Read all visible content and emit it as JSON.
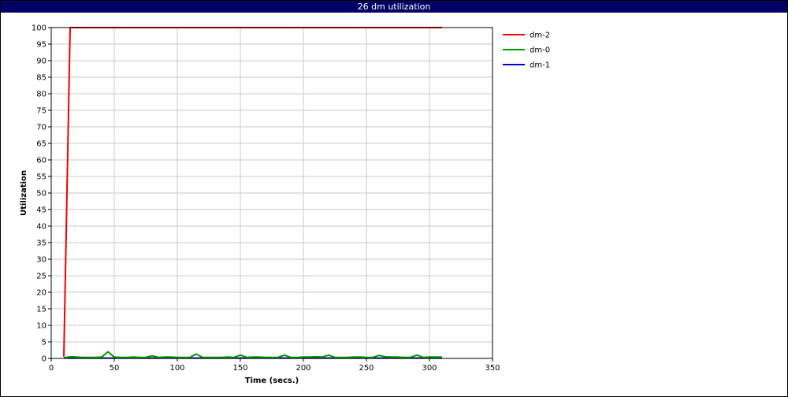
{
  "window": {
    "title": "26 dm utilization"
  },
  "chart_data": {
    "type": "line",
    "title": "26 dm utilization",
    "xlabel": "Time (secs.)",
    "ylabel": "Utilization",
    "xlim": [
      0,
      350
    ],
    "ylim": [
      0,
      100
    ],
    "xticks": [
      0,
      50,
      100,
      150,
      200,
      250,
      300,
      350
    ],
    "yticks": [
      0,
      5,
      10,
      15,
      20,
      25,
      30,
      35,
      40,
      45,
      50,
      55,
      60,
      65,
      70,
      75,
      80,
      85,
      90,
      95,
      100
    ],
    "grid": true,
    "legend_position": "right",
    "series": [
      {
        "name": "dm-2",
        "color": "#ee0000",
        "x": [
          10,
          15,
          20,
          25,
          30,
          35,
          40,
          45,
          50,
          55,
          60,
          65,
          70,
          75,
          80,
          85,
          90,
          95,
          100,
          105,
          110,
          115,
          120,
          125,
          130,
          135,
          140,
          145,
          150,
          155,
          160,
          165,
          170,
          175,
          180,
          185,
          190,
          195,
          200,
          205,
          210,
          215,
          220,
          225,
          230,
          235,
          240,
          245,
          250,
          255,
          260,
          265,
          270,
          275,
          280,
          285,
          290,
          295,
          300,
          305,
          310
        ],
        "y": [
          0.5,
          100,
          100,
          100,
          100,
          100,
          100,
          100,
          100,
          100,
          100,
          100,
          100,
          100,
          100,
          100,
          100,
          100,
          100,
          100,
          100,
          100,
          100,
          100,
          100,
          100,
          100,
          100,
          100,
          100,
          100,
          100,
          100,
          100,
          100,
          100,
          100,
          100,
          100,
          100,
          100,
          100,
          100,
          100,
          100,
          100,
          100,
          100,
          100,
          100,
          100,
          100,
          100,
          100,
          100,
          100,
          100,
          100,
          100,
          100,
          100
        ]
      },
      {
        "name": "dm-0",
        "color": "#009900",
        "x": [
          10,
          15,
          20,
          25,
          30,
          35,
          40,
          45,
          50,
          55,
          60,
          65,
          70,
          75,
          80,
          85,
          90,
          95,
          100,
          105,
          110,
          115,
          120,
          125,
          130,
          135,
          140,
          145,
          150,
          155,
          160,
          165,
          170,
          175,
          180,
          185,
          190,
          195,
          200,
          205,
          210,
          215,
          220,
          225,
          230,
          235,
          240,
          245,
          250,
          255,
          260,
          265,
          270,
          275,
          280,
          285,
          290,
          295,
          300,
          305,
          310
        ],
        "y": [
          0.2,
          0.5,
          0.4,
          0.3,
          0.3,
          0.3,
          0.4,
          2.0,
          0.4,
          0.3,
          0.3,
          0.4,
          0.3,
          0.3,
          0.8,
          0.3,
          0.4,
          0.4,
          0.3,
          0.3,
          0.3,
          1.3,
          0.3,
          0.3,
          0.3,
          0.3,
          0.4,
          0.3,
          1.0,
          0.3,
          0.4,
          0.4,
          0.3,
          0.3,
          0.3,
          1.0,
          0.3,
          0.3,
          0.4,
          0.4,
          0.5,
          0.4,
          1.0,
          0.3,
          0.3,
          0.3,
          0.4,
          0.4,
          0.3,
          0.3,
          0.9,
          0.5,
          0.4,
          0.4,
          0.3,
          0.3,
          1.0,
          0.3,
          0.4,
          0.4,
          0.4
        ]
      },
      {
        "name": "dm-1",
        "color": "#0000cc",
        "x": [
          10,
          15,
          20,
          25,
          30,
          35,
          40,
          45,
          50,
          55,
          60,
          65,
          70,
          75,
          80,
          85,
          90,
          95,
          100,
          105,
          110,
          115,
          120,
          125,
          130,
          135,
          140,
          145,
          150,
          155,
          160,
          165,
          170,
          175,
          180,
          185,
          190,
          195,
          200,
          205,
          210,
          215,
          220,
          225,
          230,
          235,
          240,
          245,
          250,
          255,
          260,
          265,
          270,
          275,
          280,
          285,
          290,
          295,
          300,
          305,
          310
        ],
        "y": [
          0.1,
          0.1,
          0.1,
          0.1,
          0.1,
          0.1,
          0.1,
          0.1,
          0.1,
          0.1,
          0.1,
          0.1,
          0.1,
          0.1,
          0.1,
          0.1,
          0.1,
          0.1,
          0.1,
          0.1,
          0.1,
          0.1,
          0.1,
          0.1,
          0.1,
          0.1,
          0.1,
          0.1,
          0.1,
          0.1,
          0.1,
          0.1,
          0.1,
          0.1,
          0.1,
          0.1,
          0.1,
          0.1,
          0.1,
          0.1,
          0.1,
          0.1,
          0.1,
          0.1,
          0.1,
          0.1,
          0.1,
          0.1,
          0.1,
          0.1,
          0.1,
          0.1,
          0.1,
          0.1,
          0.1,
          0.1,
          0.1,
          0.1,
          0.1,
          0.1,
          0.1
        ]
      }
    ]
  }
}
